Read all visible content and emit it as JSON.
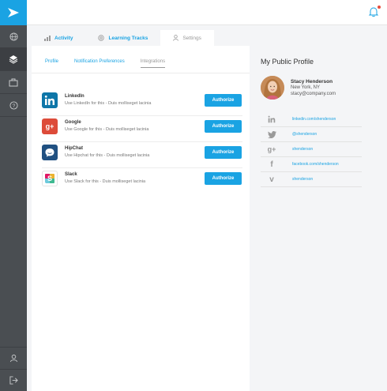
{
  "colors": {
    "accent": "#1aa3e3",
    "sidebar": "#4a4e52",
    "notification_dot": "#e74c3c"
  },
  "sidebar": {
    "logo_icon": "arrow-logo-icon",
    "items": [
      {
        "name": "globe",
        "icon": "globe-icon"
      },
      {
        "name": "layers",
        "icon": "layers-icon"
      },
      {
        "name": "briefcase",
        "icon": "briefcase-icon"
      },
      {
        "name": "help",
        "icon": "help-icon"
      }
    ],
    "bottom_items": [
      {
        "name": "user",
        "icon": "user-icon"
      },
      {
        "name": "logout",
        "icon": "logout-icon"
      }
    ]
  },
  "topbar": {
    "notification_icon": "bell-icon"
  },
  "tabs": [
    {
      "label": "Activity",
      "icon": "chart-icon"
    },
    {
      "label": "Learning Tracks",
      "icon": "target-icon"
    },
    {
      "label": "Settings",
      "icon": "user-icon",
      "active": true
    }
  ],
  "subtabs": [
    {
      "label": "Profile"
    },
    {
      "label": "Notification Preferences"
    },
    {
      "label": "Integrations",
      "active": true
    }
  ],
  "integrations": [
    {
      "name": "LinkedIn",
      "description": "Use LinkedIn for this - Duis molliseget lacinia",
      "button": "Authorize",
      "icon": "linkedin-icon",
      "color": "#0e76a8"
    },
    {
      "name": "Google",
      "description": "Use Google for this - Duis molliseget lacinia",
      "button": "Authorize",
      "icon": "google-plus-icon",
      "color": "#dd4b39"
    },
    {
      "name": "HipChat",
      "description": "Use Hipchat for this - Duis molliseget lacinia",
      "button": "Authorize",
      "icon": "hipchat-icon",
      "color": "#205081"
    },
    {
      "name": "Slack",
      "description": "Use Slack for this - Duis molliseget lacinia",
      "button": "Authorize",
      "icon": "slack-icon",
      "color": "#4a154b"
    }
  ],
  "profile": {
    "title": "My Public Profile",
    "name": "Stacy Henderson",
    "location": "New York, NY",
    "email": "stacy@company.com",
    "social": [
      {
        "icon": "linkedin-icon",
        "link": "linkedin.com/shenderson"
      },
      {
        "icon": "twitter-icon",
        "link": "@shenderson"
      },
      {
        "icon": "google-plus-icon",
        "link": "shenderson"
      },
      {
        "icon": "facebook-icon",
        "link": "facebook.com/shenderson"
      },
      {
        "icon": "vine-icon",
        "link": "shenderson"
      }
    ]
  }
}
